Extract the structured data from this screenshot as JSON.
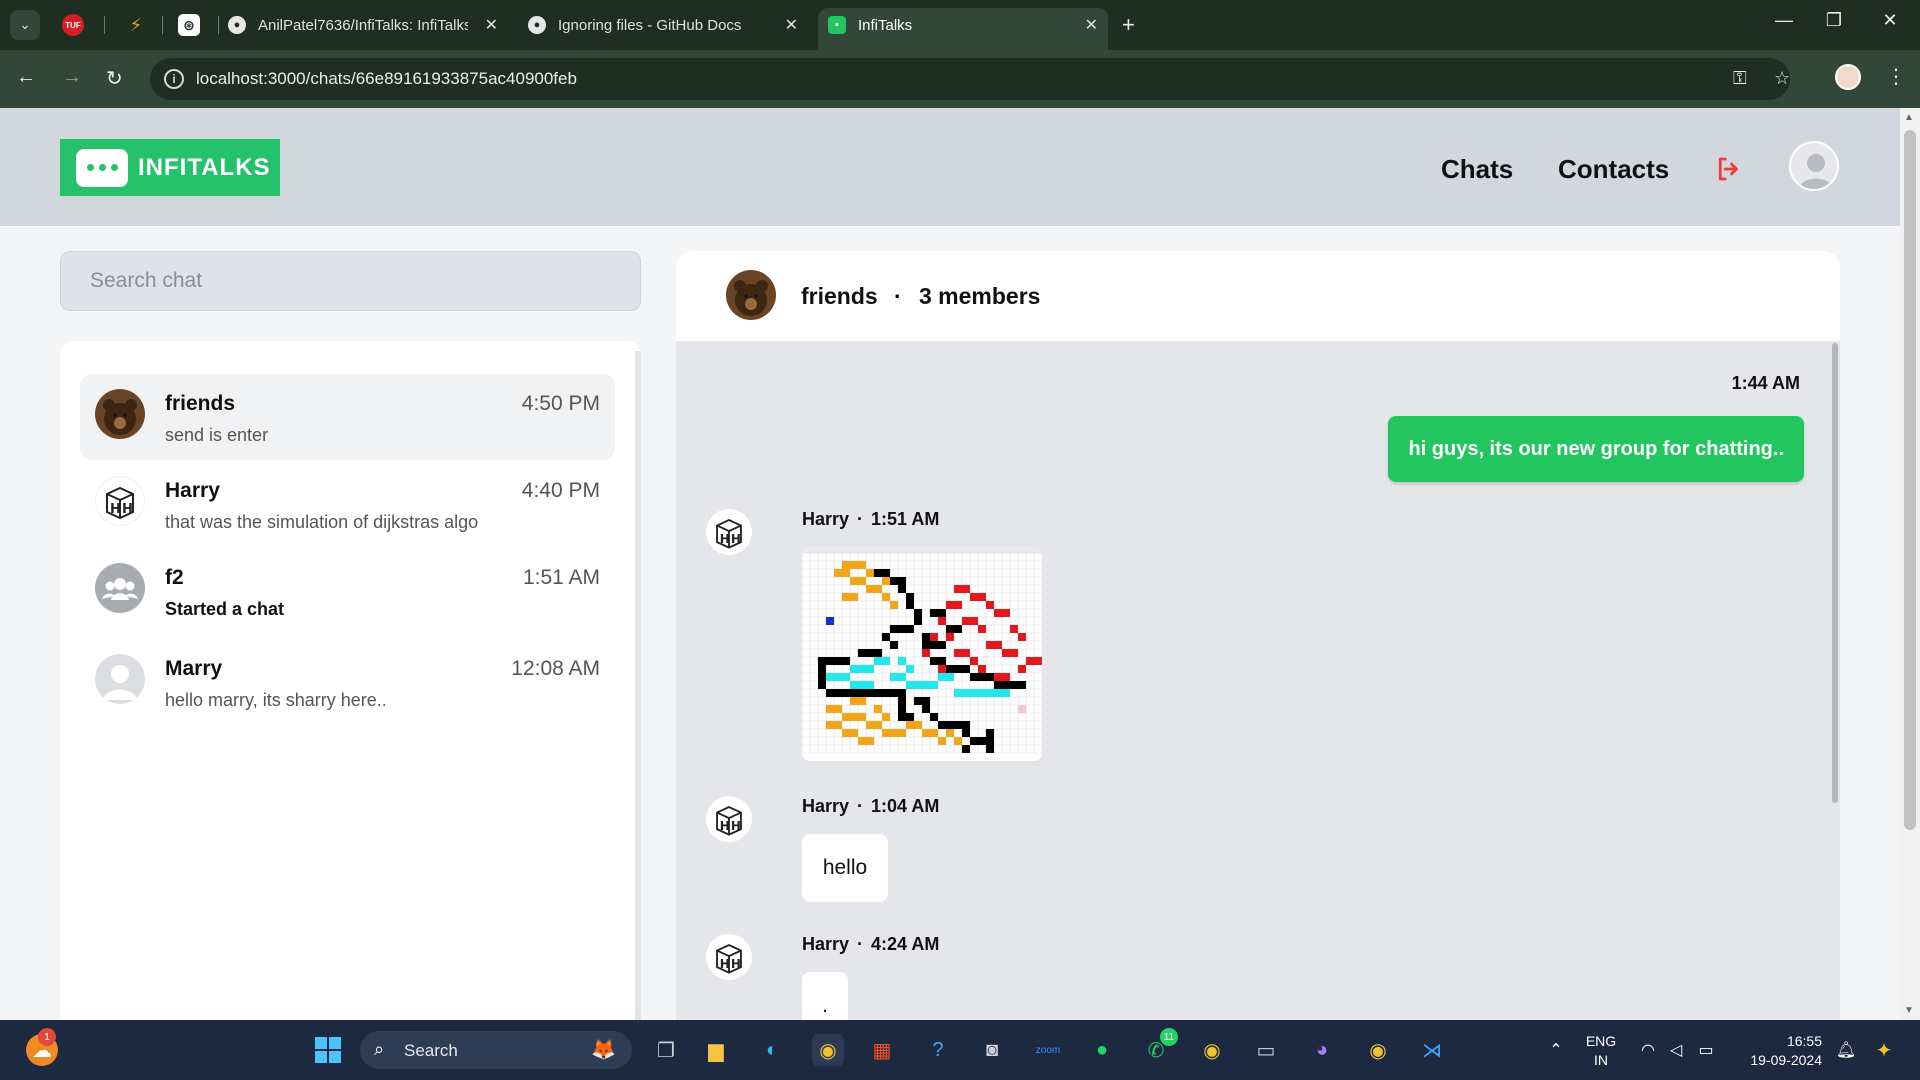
{
  "browser": {
    "tabs": [
      {
        "title": "AnilPatel7636/InfiTalks: InfiTalks"
      },
      {
        "title": "Ignoring files - GitHub Docs"
      },
      {
        "title": "InfiTalks"
      }
    ],
    "pinned_tabs": [
      {
        "label": "TUF"
      },
      {
        "label": "⚡"
      },
      {
        "label": "⊛"
      }
    ],
    "url": "localhost:3000/chats/66e89161933875ac40900feb"
  },
  "app": {
    "logo_text": "INFITALKS",
    "nav": {
      "chats": "Chats",
      "contacts": "Contacts"
    },
    "search_placeholder": "Search chat",
    "chats": [
      {
        "name": "friends",
        "preview": "send is enter",
        "time": "4:50 PM",
        "avatar": "bear-photo"
      },
      {
        "name": "Harry",
        "preview": "that was the simulation of dijkstras algo",
        "time": "4:40 PM",
        "avatar": "h-cube"
      },
      {
        "name": "f2",
        "preview": "Started a chat",
        "time": "1:51 AM",
        "avatar": "group-icon"
      },
      {
        "name": "Marry",
        "preview": "hello marry, its sharry here..",
        "time": "12:08 AM",
        "avatar": "default-user"
      }
    ],
    "conversation": {
      "name": "friends",
      "separator": "·",
      "members": "3 members",
      "messages": [
        {
          "direction": "out",
          "time": "1:44 AM",
          "text": "hi guys, its our new group for chatting.."
        },
        {
          "direction": "in",
          "sender": "Harry",
          "time": "1:51 AM",
          "type": "image"
        },
        {
          "direction": "in",
          "sender": "Harry",
          "time": "1:04 AM",
          "text": "hello"
        },
        {
          "direction": "in",
          "sender": "Harry",
          "time": "4:24 AM",
          "text": "."
        }
      ]
    }
  },
  "taskbar": {
    "search_label": "Search",
    "lang_1": "ENG",
    "lang_2": "IN",
    "time": "16:55",
    "date": "19-09-2024",
    "badges": {
      "weather": "1",
      "whatsapp": "11"
    }
  },
  "colors": {
    "accent": "#22c55e",
    "header_bg": "#d2d6dd",
    "logout": "#ef3b3b",
    "maze_orange": "#f2a516",
    "maze_red": "#e5161c",
    "maze_cyan": "#22e7ec"
  }
}
